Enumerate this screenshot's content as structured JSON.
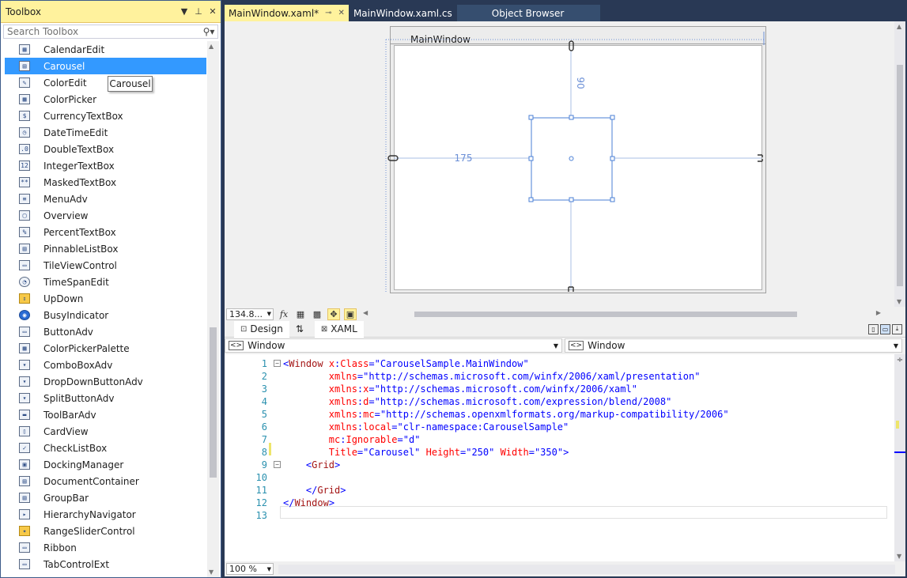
{
  "toolbox": {
    "title": "Toolbox",
    "search_placeholder": "Search Toolbox",
    "tooltip": "Carousel",
    "items": [
      {
        "label": "CalendarEdit",
        "icon": "calendar-icon"
      },
      {
        "label": "Carousel",
        "icon": "carousel-icon",
        "selected": true
      },
      {
        "label": "ColorEdit",
        "icon": "color-edit-icon"
      },
      {
        "label": "ColorPicker",
        "icon": "color-picker-icon"
      },
      {
        "label": "CurrencyTextBox",
        "icon": "currency-icon"
      },
      {
        "label": "DateTimeEdit",
        "icon": "datetime-icon"
      },
      {
        "label": "DoubleTextBox",
        "icon": "double-textbox-icon"
      },
      {
        "label": "IntegerTextBox",
        "icon": "integer-textbox-icon"
      },
      {
        "label": "MaskedTextBox",
        "icon": "masked-textbox-icon"
      },
      {
        "label": "MenuAdv",
        "icon": "menu-icon"
      },
      {
        "label": "Overview",
        "icon": "overview-icon"
      },
      {
        "label": "PercentTextBox",
        "icon": "percent-textbox-icon"
      },
      {
        "label": "PinnableListBox",
        "icon": "pinnable-listbox-icon"
      },
      {
        "label": "TileViewControl",
        "icon": "tileview-icon"
      },
      {
        "label": "TimeSpanEdit",
        "icon": "timespan-icon"
      },
      {
        "label": "UpDown",
        "icon": "updown-icon"
      },
      {
        "label": "BusyIndicator",
        "icon": "busy-indicator-icon"
      },
      {
        "label": "ButtonAdv",
        "icon": "button-icon"
      },
      {
        "label": "ColorPickerPalette",
        "icon": "color-palette-icon"
      },
      {
        "label": "ComboBoxAdv",
        "icon": "combobox-icon"
      },
      {
        "label": "DropDownButtonAdv",
        "icon": "dropdown-button-icon"
      },
      {
        "label": "SplitButtonAdv",
        "icon": "split-button-icon"
      },
      {
        "label": "ToolBarAdv",
        "icon": "toolbar-icon"
      },
      {
        "label": "CardView",
        "icon": "cardview-icon"
      },
      {
        "label": "CheckListBox",
        "icon": "checklistbox-icon"
      },
      {
        "label": "DockingManager",
        "icon": "docking-manager-icon"
      },
      {
        "label": "DocumentContainer",
        "icon": "document-container-icon"
      },
      {
        "label": "GroupBar",
        "icon": "groupbar-icon"
      },
      {
        "label": "HierarchyNavigator",
        "icon": "hierarchy-navigator-icon"
      },
      {
        "label": "RangeSliderControl",
        "icon": "range-slider-icon"
      },
      {
        "label": "Ribbon",
        "icon": "ribbon-icon"
      },
      {
        "label": "TabControlExt",
        "icon": "tabcontrol-icon"
      }
    ]
  },
  "tabs": [
    {
      "label": "MainWindow.xaml*",
      "active": true
    },
    {
      "label": "MainWindow.xaml.cs",
      "active": false
    },
    {
      "label": "Object Browser",
      "active": false
    }
  ],
  "designer": {
    "window_title": "MainWindow",
    "margin_top": "90",
    "margin_left": "175",
    "zoom": "134.8...",
    "hscroll_value": 0.18
  },
  "view_tabs": {
    "design": "Design",
    "swap": "⇅",
    "xaml": "XAML"
  },
  "nav": {
    "left": "Window",
    "right": "Window"
  },
  "code": {
    "zoom": "100 %",
    "lines": [
      {
        "n": "1",
        "tokens": [
          [
            "t-punc",
            "<"
          ],
          [
            "t-tag",
            "Window"
          ],
          [
            "t-attr",
            " x"
          ],
          [
            "t-punc",
            ":"
          ],
          [
            "t-attr",
            "Class"
          ],
          [
            "t-punc",
            "=\""
          ],
          [
            "t-val",
            "CarouselSample.MainWindow"
          ],
          [
            "t-punc",
            "\""
          ]
        ]
      },
      {
        "n": "2",
        "tokens": [
          [
            "t-attr",
            "        xmlns"
          ],
          [
            "t-punc",
            "=\""
          ],
          [
            "t-val",
            "http://schemas.microsoft.com/winfx/2006/xaml/presentation"
          ],
          [
            "t-punc",
            "\""
          ]
        ]
      },
      {
        "n": "3",
        "tokens": [
          [
            "t-attr",
            "        xmlns"
          ],
          [
            "t-punc",
            ":"
          ],
          [
            "t-attr",
            "x"
          ],
          [
            "t-punc",
            "=\""
          ],
          [
            "t-val",
            "http://schemas.microsoft.com/winfx/2006/xaml"
          ],
          [
            "t-punc",
            "\""
          ]
        ]
      },
      {
        "n": "4",
        "tokens": [
          [
            "t-attr",
            "        xmlns"
          ],
          [
            "t-punc",
            ":"
          ],
          [
            "t-attr",
            "d"
          ],
          [
            "t-punc",
            "=\""
          ],
          [
            "t-val",
            "http://schemas.microsoft.com/expression/blend/2008"
          ],
          [
            "t-punc",
            "\""
          ]
        ]
      },
      {
        "n": "5",
        "tokens": [
          [
            "t-attr",
            "        xmlns"
          ],
          [
            "t-punc",
            ":"
          ],
          [
            "t-attr",
            "mc"
          ],
          [
            "t-punc",
            "=\""
          ],
          [
            "t-val",
            "http://schemas.openxmlformats.org/markup-compatibility/2006"
          ],
          [
            "t-punc",
            "\""
          ]
        ]
      },
      {
        "n": "6",
        "tokens": [
          [
            "t-attr",
            "        xmlns"
          ],
          [
            "t-punc",
            ":"
          ],
          [
            "t-attr",
            "local"
          ],
          [
            "t-punc",
            "=\""
          ],
          [
            "t-val",
            "clr-namespace:CarouselSample"
          ],
          [
            "t-punc",
            "\""
          ]
        ]
      },
      {
        "n": "7",
        "tokens": [
          [
            "t-attr",
            "        mc"
          ],
          [
            "t-punc",
            ":"
          ],
          [
            "t-attr",
            "Ignorable"
          ],
          [
            "t-punc",
            "=\""
          ],
          [
            "t-val",
            "d"
          ],
          [
            "t-punc",
            "\""
          ]
        ]
      },
      {
        "n": "8",
        "tokens": [
          [
            "t-attr",
            "        Title"
          ],
          [
            "t-punc",
            "=\""
          ],
          [
            "t-val",
            "Carousel"
          ],
          [
            "t-punc",
            "\""
          ],
          [
            "t-attr",
            " Height"
          ],
          [
            "t-punc",
            "=\""
          ],
          [
            "t-val",
            "250"
          ],
          [
            "t-punc",
            "\""
          ],
          [
            "t-attr",
            " Width"
          ],
          [
            "t-punc",
            "=\""
          ],
          [
            "t-val",
            "350"
          ],
          [
            "t-punc",
            "\">"
          ]
        ]
      },
      {
        "n": "9",
        "tokens": [
          [
            "t-punc",
            "    <"
          ],
          [
            "t-tag",
            "Grid"
          ],
          [
            "t-punc",
            ">"
          ]
        ]
      },
      {
        "n": "10",
        "tokens": []
      },
      {
        "n": "11",
        "tokens": [
          [
            "t-punc",
            "    </"
          ],
          [
            "t-tag",
            "Grid"
          ],
          [
            "t-punc",
            ">"
          ]
        ]
      },
      {
        "n": "12",
        "tokens": [
          [
            "t-punc",
            "</"
          ],
          [
            "t-tag",
            "Window"
          ],
          [
            "t-punc",
            ">"
          ]
        ]
      },
      {
        "n": "13",
        "tokens": []
      }
    ]
  },
  "colors": {
    "chrome": "#293955",
    "accent_yellow": "#fff29d",
    "selection": "#3399ff",
    "guide": "#6b8fd6"
  }
}
